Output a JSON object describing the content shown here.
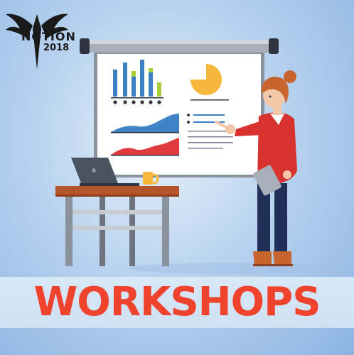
{
  "logo": {
    "name": "NOTION",
    "year": "2018",
    "icon": "winged-emblem-icon"
  },
  "banner": {
    "title": "WORKSHOPS",
    "color": "#f0432d"
  },
  "colors": {
    "bar_blue": "#3d7fc3",
    "bar_green": "#a8cf3a",
    "pie": "#f6b73c",
    "area_blue": "#3f82c6",
    "area_red": "#e0393e",
    "shirt": "#d7322f",
    "hair": "#c8652e",
    "pants": "#1f2f57"
  }
}
